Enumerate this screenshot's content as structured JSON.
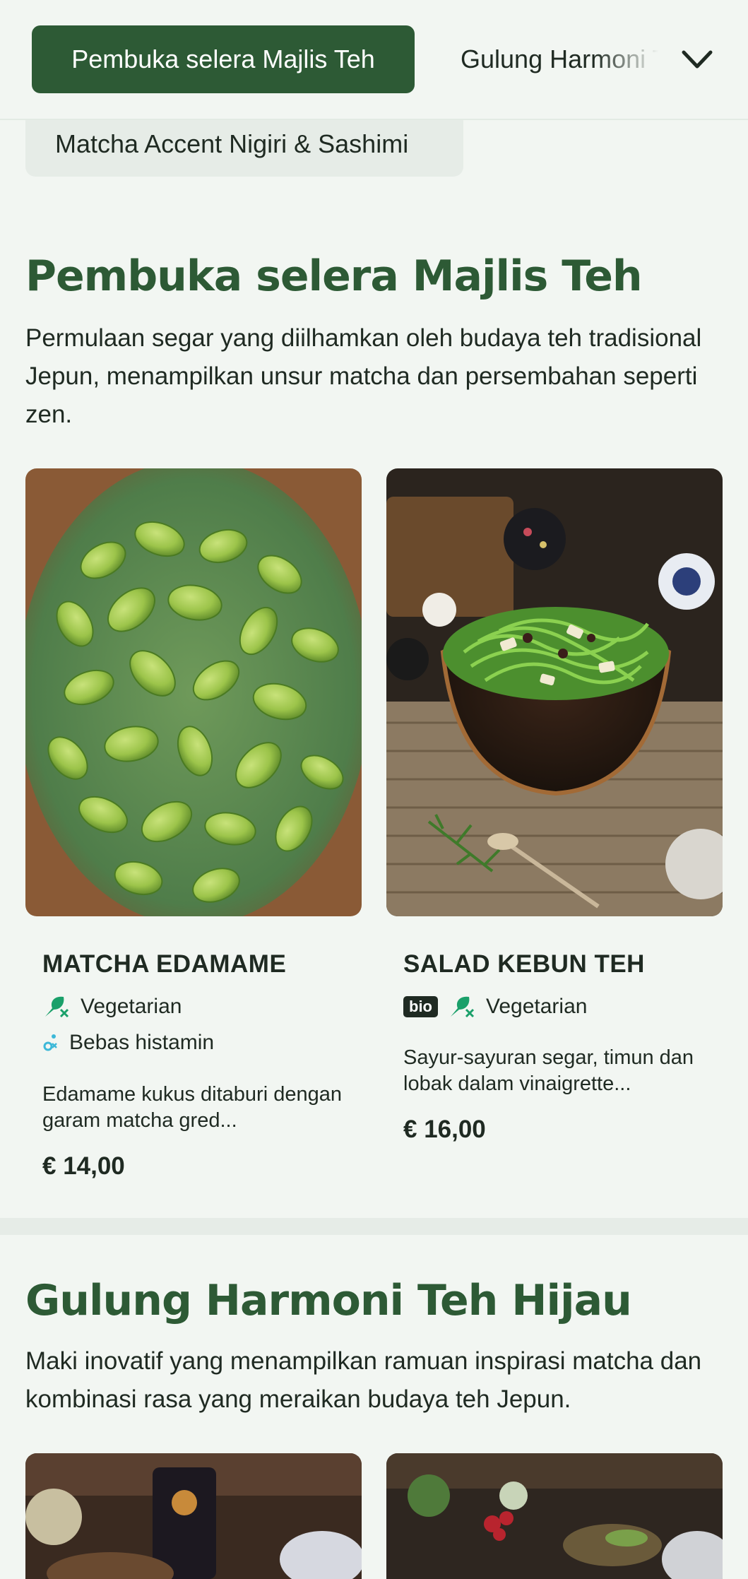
{
  "nav": {
    "active_label": "Pembuka selera Majlis Teh",
    "next_label": "Gulung Harmoni Teh Hijau",
    "prev_label": "Matcha Accent Nigiri & Sashimi"
  },
  "sections": [
    {
      "title": "Pembuka selera Majlis Teh",
      "description": "Permulaan segar yang diilhamkan oleh budaya teh tradisional Jepun, menampilkan unsur matcha dan persembahan seperti zen.",
      "items": [
        {
          "name": "MATCHA EDAMAME",
          "tags": [
            {
              "icon": "vegetarian-icon",
              "label": "Vegetarian"
            },
            {
              "icon": "histamine-free-icon",
              "label": "Bebas histamin"
            }
          ],
          "description": "Edamame kukus ditaburi dengan garam matcha gred...",
          "price": "€ 14,00"
        },
        {
          "name": "SALAD KEBUN TEH",
          "badge": "bio",
          "tags": [
            {
              "icon": "vegetarian-icon",
              "label": "Vegetarian"
            }
          ],
          "description": "Sayur-sayuran segar, timun dan lobak dalam vinaigrette...",
          "price": "€ 16,00"
        }
      ]
    },
    {
      "title": "Gulung Harmoni Teh Hijau",
      "description": "Maki inovatif yang menampilkan ramuan inspirasi matcha dan kombinasi rasa yang meraikan budaya teh Jepun."
    }
  ],
  "colors": {
    "brand_green": "#2d5a35",
    "background": "#f2f6f2",
    "tag_green": "#1aa06a",
    "histamine_blue": "#3cb8d8"
  }
}
